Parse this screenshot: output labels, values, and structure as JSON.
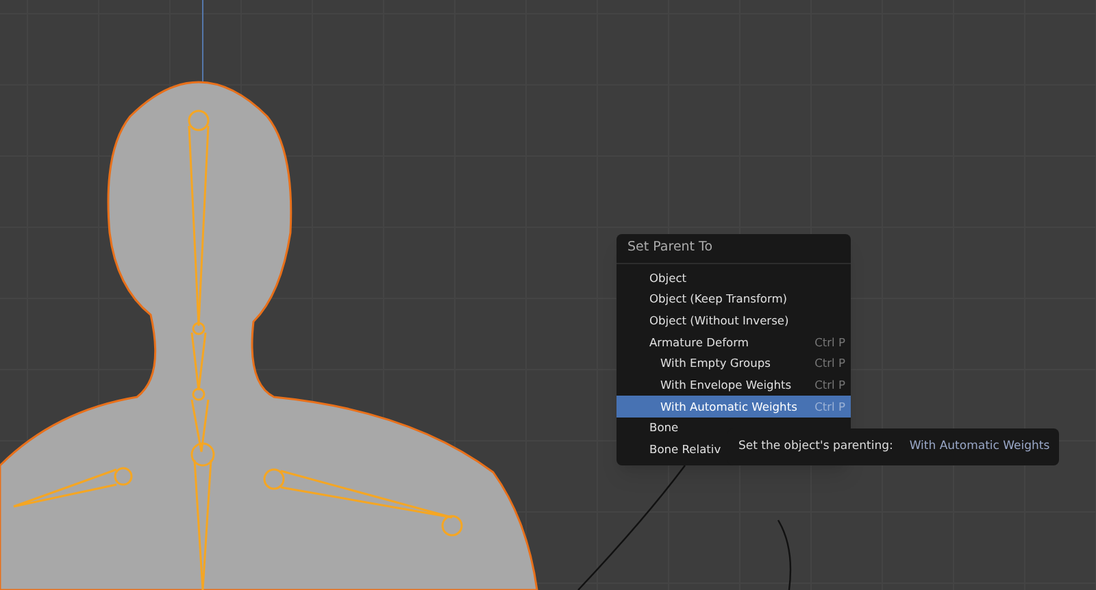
{
  "menu": {
    "title": "Set Parent To",
    "items": [
      {
        "label": "Object",
        "selected": false
      },
      {
        "label": "Object (Keep Transform)",
        "selected": false
      },
      {
        "label": "Object (Without Inverse)",
        "selected": false
      },
      {
        "label": "Armature Deform",
        "shortcut": "Ctrl P",
        "selected": false,
        "children": [
          {
            "label": "With Empty Groups",
            "shortcut": "Ctrl P",
            "selected": false
          },
          {
            "label": "With Envelope Weights",
            "shortcut": "Ctrl P",
            "selected": false
          },
          {
            "label": "With Automatic Weights",
            "shortcut": "Ctrl P",
            "selected": true
          }
        ]
      },
      {
        "label": "Bone",
        "selected": false
      },
      {
        "label": "Bone Relativ",
        "selected": false
      }
    ]
  },
  "tooltip": {
    "label": "Set the object's parenting:",
    "value": "With Automatic Weights"
  }
}
